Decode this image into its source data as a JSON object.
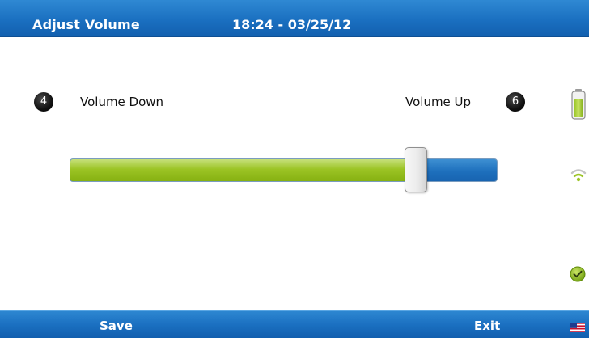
{
  "header": {
    "title": "Adjust Volume",
    "datetime": "18:24 - 03/25/12"
  },
  "volume": {
    "down_key": "4",
    "down_label": "Volume Down",
    "up_key": "6",
    "up_label": "Volume Up",
    "level_fraction": 0.81
  },
  "status": {
    "battery_icon": "battery-full-icon",
    "wifi_icon": "wifi-icon",
    "check_icon": "check-circle-icon"
  },
  "footer": {
    "save_label": "Save",
    "exit_label": "Exit",
    "language_icon": "us-flag-icon"
  },
  "colors": {
    "bar_blue": "#1a6fc0",
    "fill_green": "#9cc425",
    "track_blue": "#1e70bd"
  }
}
